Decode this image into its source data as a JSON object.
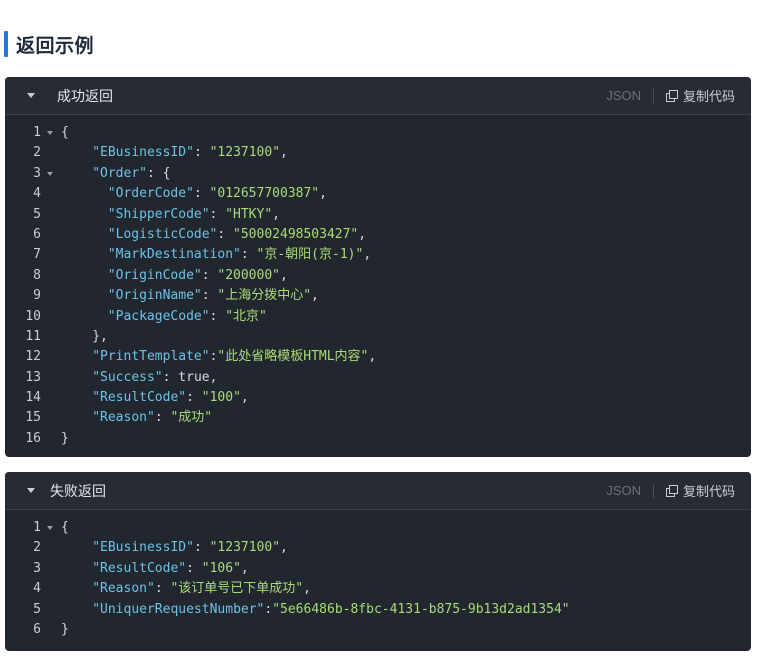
{
  "section_title": "返回示例",
  "panels": [
    {
      "id": "success",
      "label": "成功返回",
      "lang": "JSON",
      "copy_label": "复制代码",
      "lines": [
        {
          "n": "1",
          "fold": true,
          "indent": 0,
          "tokens": [
            {
              "t": "{",
              "c": "punc"
            }
          ]
        },
        {
          "n": "2",
          "indent": 4,
          "tokens": [
            {
              "t": "\"EBusinessID\"",
              "c": "key"
            },
            {
              "t": ": ",
              "c": "punc"
            },
            {
              "t": "\"1237100\"",
              "c": "str"
            },
            {
              "t": ",",
              "c": "punc"
            }
          ]
        },
        {
          "n": "3",
          "fold": true,
          "indent": 4,
          "tokens": [
            {
              "t": "\"Order\"",
              "c": "key"
            },
            {
              "t": ": {",
              "c": "punc"
            }
          ]
        },
        {
          "n": "4",
          "indent": 6,
          "tokens": [
            {
              "t": "\"OrderCode\"",
              "c": "key"
            },
            {
              "t": ": ",
              "c": "punc"
            },
            {
              "t": "\"012657700387\"",
              "c": "str"
            },
            {
              "t": ",",
              "c": "punc"
            }
          ]
        },
        {
          "n": "5",
          "indent": 6,
          "tokens": [
            {
              "t": "\"ShipperCode\"",
              "c": "key"
            },
            {
              "t": ": ",
              "c": "punc"
            },
            {
              "t": "\"HTKY\"",
              "c": "str"
            },
            {
              "t": ",",
              "c": "punc"
            }
          ]
        },
        {
          "n": "6",
          "indent": 6,
          "tokens": [
            {
              "t": "\"LogisticCode\"",
              "c": "key"
            },
            {
              "t": ": ",
              "c": "punc"
            },
            {
              "t": "\"50002498503427\"",
              "c": "str"
            },
            {
              "t": ",",
              "c": "punc"
            }
          ]
        },
        {
          "n": "7",
          "indent": 6,
          "tokens": [
            {
              "t": "\"MarkDestination\"",
              "c": "key"
            },
            {
              "t": ": ",
              "c": "punc"
            },
            {
              "t": "\"京-朝阳(京-1)\"",
              "c": "str"
            },
            {
              "t": ",",
              "c": "punc"
            }
          ]
        },
        {
          "n": "8",
          "indent": 6,
          "tokens": [
            {
              "t": "\"OriginCode\"",
              "c": "key"
            },
            {
              "t": ": ",
              "c": "punc"
            },
            {
              "t": "\"200000\"",
              "c": "str"
            },
            {
              "t": ",",
              "c": "punc"
            }
          ]
        },
        {
          "n": "9",
          "indent": 6,
          "tokens": [
            {
              "t": "\"OriginName\"",
              "c": "key"
            },
            {
              "t": ": ",
              "c": "punc"
            },
            {
              "t": "\"上海分拨中心\"",
              "c": "str"
            },
            {
              "t": ",",
              "c": "punc"
            }
          ]
        },
        {
          "n": "10",
          "indent": 6,
          "tokens": [
            {
              "t": "\"PackageCode\"",
              "c": "key"
            },
            {
              "t": ": ",
              "c": "punc"
            },
            {
              "t": "\"北京\"",
              "c": "str"
            }
          ]
        },
        {
          "n": "11",
          "indent": 4,
          "tokens": [
            {
              "t": "},",
              "c": "punc"
            }
          ]
        },
        {
          "n": "12",
          "indent": 4,
          "tokens": [
            {
              "t": "\"PrintTemplate\"",
              "c": "key"
            },
            {
              "t": ":",
              "c": "punc"
            },
            {
              "t": "\"此处省略模板HTML内容\"",
              "c": "str"
            },
            {
              "t": ",",
              "c": "punc"
            }
          ]
        },
        {
          "n": "13",
          "indent": 4,
          "tokens": [
            {
              "t": "\"Success\"",
              "c": "key"
            },
            {
              "t": ": ",
              "c": "punc"
            },
            {
              "t": "true",
              "c": "lit"
            },
            {
              "t": ",",
              "c": "punc"
            }
          ]
        },
        {
          "n": "14",
          "indent": 4,
          "tokens": [
            {
              "t": "\"ResultCode\"",
              "c": "key"
            },
            {
              "t": ": ",
              "c": "punc"
            },
            {
              "t": "\"100\"",
              "c": "str"
            },
            {
              "t": ",",
              "c": "punc"
            }
          ]
        },
        {
          "n": "15",
          "indent": 4,
          "tokens": [
            {
              "t": "\"Reason\"",
              "c": "key"
            },
            {
              "t": ": ",
              "c": "punc"
            },
            {
              "t": "\"成功\"",
              "c": "str"
            }
          ]
        },
        {
          "n": "16",
          "indent": 0,
          "tokens": [
            {
              "t": "}",
              "c": "punc"
            }
          ]
        }
      ]
    },
    {
      "id": "fail",
      "label": "失败返回",
      "lang": "JSON",
      "copy_label": "复制代码",
      "lines": [
        {
          "n": "1",
          "fold": true,
          "indent": 0,
          "tokens": [
            {
              "t": "{",
              "c": "punc"
            }
          ]
        },
        {
          "n": "2",
          "indent": 4,
          "tokens": [
            {
              "t": "\"EBusinessID\"",
              "c": "key"
            },
            {
              "t": ": ",
              "c": "punc"
            },
            {
              "t": "\"1237100\"",
              "c": "str"
            },
            {
              "t": ",",
              "c": "punc"
            }
          ]
        },
        {
          "n": "3",
          "indent": 4,
          "tokens": [
            {
              "t": "\"ResultCode\"",
              "c": "key"
            },
            {
              "t": ": ",
              "c": "punc"
            },
            {
              "t": "\"106\"",
              "c": "str"
            },
            {
              "t": ",",
              "c": "punc"
            }
          ]
        },
        {
          "n": "4",
          "indent": 4,
          "tokens": [
            {
              "t": "\"Reason\"",
              "c": "key"
            },
            {
              "t": ": ",
              "c": "punc"
            },
            {
              "t": "\"该订单号已下单成功\"",
              "c": "str"
            },
            {
              "t": ",",
              "c": "punc"
            }
          ]
        },
        {
          "n": "5",
          "indent": 4,
          "tokens": [
            {
              "t": "\"UniquerRequestNumber\"",
              "c": "key"
            },
            {
              "t": ":",
              "c": "punc"
            },
            {
              "t": "\"5e66486b-8fbc-4131-b875-9b13d2ad1354\"",
              "c": "str"
            }
          ]
        },
        {
          "n": "6",
          "indent": 0,
          "tokens": [
            {
              "t": "}",
              "c": "punc"
            }
          ]
        }
      ]
    }
  ],
  "colors": {
    "accent": "#1f7ae0",
    "panel_bg": "#22262f",
    "key": "#6cc3e6",
    "string": "#a9dc76"
  }
}
